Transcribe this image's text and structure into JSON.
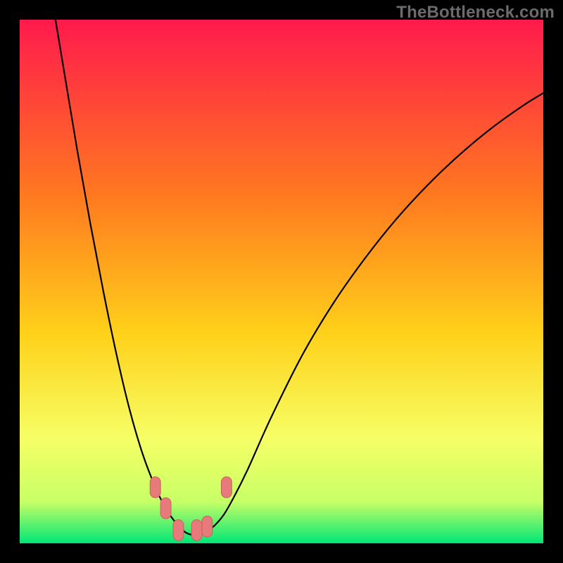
{
  "watermark": {
    "text": "TheBottleneck.com"
  },
  "colors": {
    "bg": "#000000",
    "grad_top": "#ff1a4d",
    "grad_mid1": "#ff7a1f",
    "grad_mid2": "#ffd11a",
    "grad_mid3": "#f6ff66",
    "grad_mid4": "#c8ff66",
    "grad_bottom": "#00e676",
    "curve": "#000000",
    "marker_fill": "#e77b7b",
    "marker_stroke": "#cc5e5e"
  },
  "chart_data": {
    "type": "line",
    "title": "",
    "xlabel": "",
    "ylabel": "",
    "xlim": [
      0,
      100
    ],
    "ylim": [
      0,
      100
    ],
    "grid": false,
    "annotations": [
      "TheBottleneck.com"
    ],
    "curve_points_norm": [
      [
        0.06,
        -0.05
      ],
      [
        0.085,
        0.1
      ],
      [
        0.11,
        0.25
      ],
      [
        0.135,
        0.39
      ],
      [
        0.16,
        0.52
      ],
      [
        0.185,
        0.64
      ],
      [
        0.21,
        0.745
      ],
      [
        0.235,
        0.83
      ],
      [
        0.26,
        0.895
      ],
      [
        0.28,
        0.935
      ],
      [
        0.3,
        0.963
      ],
      [
        0.318,
        0.98
      ],
      [
        0.335,
        0.984
      ],
      [
        0.352,
        0.98
      ],
      [
        0.37,
        0.968
      ],
      [
        0.39,
        0.945
      ],
      [
        0.41,
        0.91
      ],
      [
        0.435,
        0.86
      ],
      [
        0.48,
        0.76
      ],
      [
        0.54,
        0.64
      ],
      [
        0.6,
        0.54
      ],
      [
        0.66,
        0.455
      ],
      [
        0.72,
        0.38
      ],
      [
        0.78,
        0.315
      ],
      [
        0.84,
        0.258
      ],
      [
        0.9,
        0.208
      ],
      [
        0.96,
        0.165
      ],
      [
        1.0,
        0.14
      ]
    ],
    "markers_norm": [
      [
        0.259,
        0.893
      ],
      [
        0.279,
        0.933
      ],
      [
        0.303,
        0.975
      ],
      [
        0.338,
        0.975
      ],
      [
        0.358,
        0.968
      ],
      [
        0.395,
        0.893
      ]
    ],
    "marker_rx": 0.01,
    "marker_ry": 0.02
  }
}
